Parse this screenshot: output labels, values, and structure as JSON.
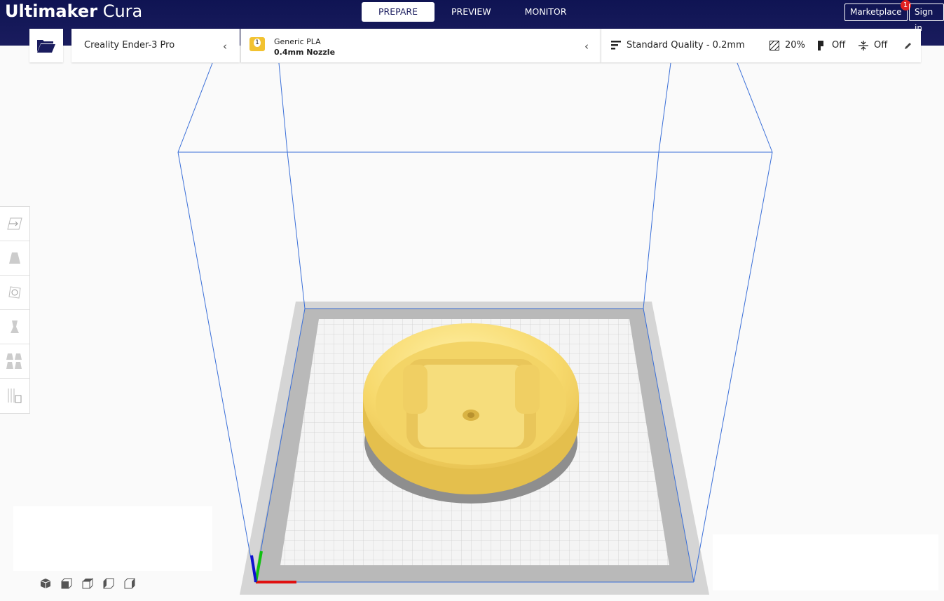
{
  "app": {
    "logo_bold": "Ultimaker",
    "logo_light": "Cura"
  },
  "stages": [
    {
      "label": "PREPARE",
      "active": true
    },
    {
      "label": "PREVIEW",
      "active": false
    },
    {
      "label": "MONITOR",
      "active": false
    }
  ],
  "header": {
    "marketplace_label": "Marketplace",
    "marketplace_badge": "1",
    "signin_label": "Sign in"
  },
  "printer": {
    "name": "Creality Ender-3 Pro"
  },
  "material": {
    "badge": "1",
    "name": "Generic PLA",
    "nozzle": "0.4mm Nozzle"
  },
  "print_settings": {
    "profile": "Standard Quality - 0.2mm",
    "infill": "20%",
    "support": "Off",
    "adhesion": "Off"
  },
  "tools": [
    {
      "name": "move-tool",
      "icon": "move-icon"
    },
    {
      "name": "scale-tool",
      "icon": "scale-icon"
    },
    {
      "name": "rotate-tool",
      "icon": "rotate-icon"
    },
    {
      "name": "mirror-tool",
      "icon": "mirror-icon"
    },
    {
      "name": "per-model-settings-tool",
      "icon": "per-model-settings-icon"
    },
    {
      "name": "support-blocker-tool",
      "icon": "support-blocker-icon"
    }
  ],
  "colors": {
    "header": "#1a1c5e",
    "model": "#f6d86a",
    "build_volume": "#3a6fd8",
    "accent_badge": "#e02020"
  }
}
